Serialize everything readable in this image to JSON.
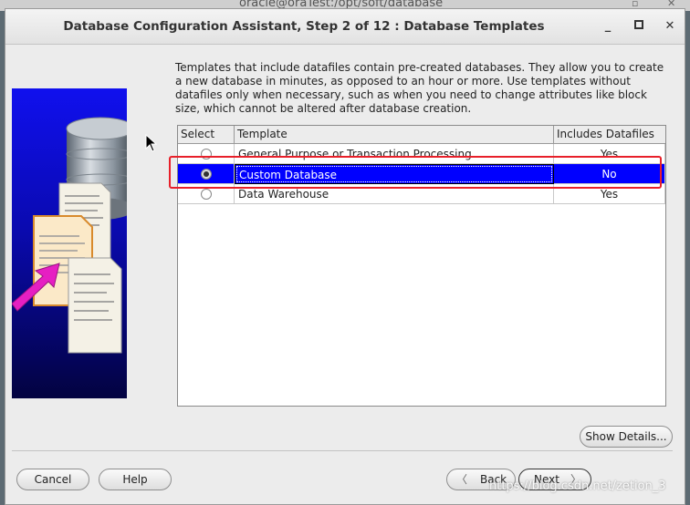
{
  "background_window": {
    "title": "oracle@oraTest:/opt/soft/database"
  },
  "window": {
    "title": "Database Configuration Assistant, Step 2 of 12 : Database Templates"
  },
  "description": "Templates that include datafiles contain pre-created databases. They allow you to create a new database in minutes, as opposed to an hour or more. Use templates without datafiles only when necessary, such as when you need to change attributes like block size, which cannot be altered after database creation.",
  "table": {
    "columns": [
      "Select",
      "Template",
      "Includes Datafiles"
    ],
    "rows": [
      {
        "template": "General Purpose or Transaction Processing",
        "includes_datafiles": "Yes",
        "selected": false
      },
      {
        "template": "Custom Database",
        "includes_datafiles": "No",
        "selected": true
      },
      {
        "template": "Data Warehouse",
        "includes_datafiles": "Yes",
        "selected": false
      }
    ]
  },
  "buttons": {
    "show_details": "Show Details...",
    "cancel": "Cancel",
    "help": "Help",
    "back": "Back",
    "next": "Next"
  },
  "watermark": "https://blog.csdn.net/zetion_3",
  "colors": {
    "selection": "#0000ff",
    "highlight_box": "#e8202a",
    "side_panel": "#1010ee"
  }
}
